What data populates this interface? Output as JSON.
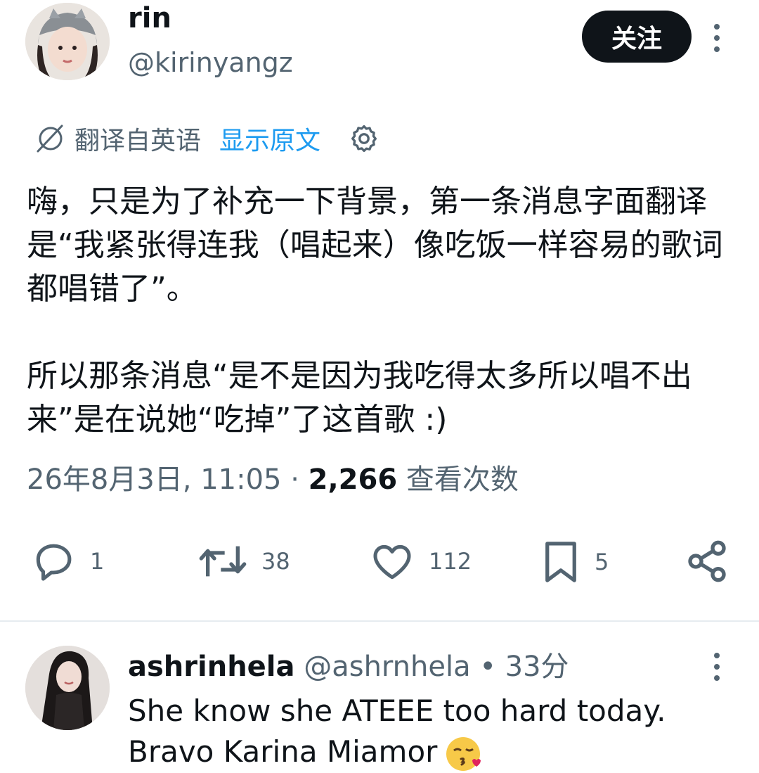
{
  "tweet": {
    "author_name": "rin",
    "author_handle": "@kirinyangz",
    "follow_label": "关注",
    "translation": {
      "label": "翻译自英语",
      "show_original": "显示原文"
    },
    "paragraphs": [
      "嗨，只是为了补充一下背景，第一条消息字面翻译是“我紧张得连我（唱起来）像吃饭一样容易的歌词都唱错了”。",
      "所以那条消息“是不是因为我吃得太多所以唱不出来”是在说她“吃掉”了这首歌 :)"
    ],
    "timestamp": "26年8月3日, 11:05",
    "separator": "·",
    "views_count": "2,266",
    "views_label": "查看次数",
    "actions": {
      "reply_count": "1",
      "retweet_count": "38",
      "like_count": "112",
      "bookmark_count": "5"
    }
  },
  "reply": {
    "name": "ashrinhela",
    "handle_time": "@ashrnhela • 33分",
    "lines": [
      "She know she ATEEE too hard today.",
      "Bravo Karina Miamor"
    ]
  },
  "icons": {
    "more": "more-vertical-icon",
    "translate": "translate-icon",
    "settings": "gear-icon",
    "reply": "reply-bubble-icon",
    "retweet": "retweet-icon",
    "like": "heart-icon",
    "bookmark": "bookmark-icon",
    "share": "share-icon",
    "emoji": "kissing-face-emoji"
  },
  "colors": {
    "text": "#0f1419",
    "secondary": "#536471",
    "link": "#1d9bf0",
    "button_bg": "#0f1419"
  }
}
